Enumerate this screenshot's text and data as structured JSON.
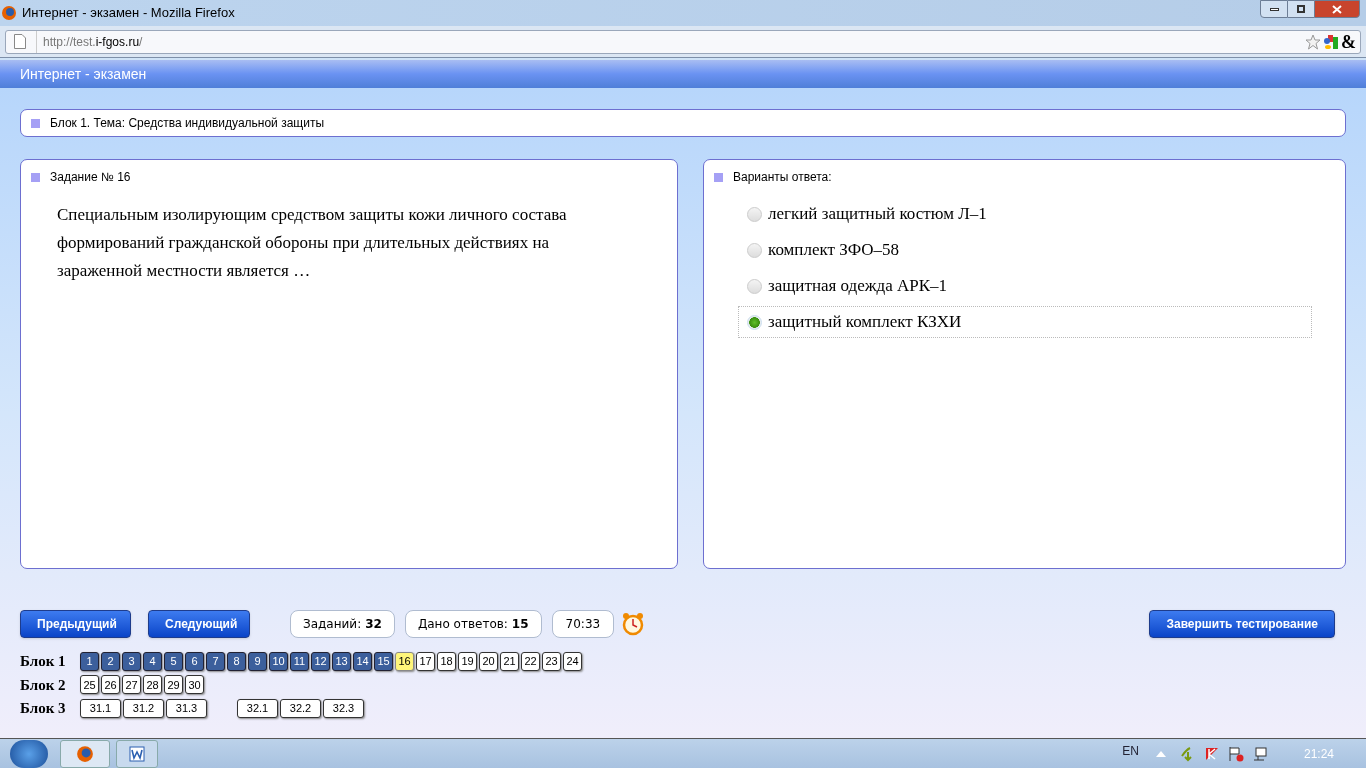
{
  "window": {
    "title": "Интернет - экзамен - Mozilla Firefox"
  },
  "address_bar": {
    "url_prefix": "http://test.",
    "url_domain": "i-fgos.ru",
    "url_suffix": "/",
    "addon_glyph": "&"
  },
  "app_header": {
    "title": "Интернет - экзамен"
  },
  "block_bar": {
    "label": "Блок 1. Тема: Средства индивидуальной защиты"
  },
  "question": {
    "heading": "Задание № 16",
    "text": "Специальным изолирующим средством защиты кожи личного состава формирований гражданской обороны при длительных действиях на зараженной местности является …"
  },
  "answers": {
    "heading": "Варианты ответа:",
    "options": [
      {
        "label": "легкий защитный костюм Л–1",
        "selected": false
      },
      {
        "label": "комплект ЗФО–58",
        "selected": false
      },
      {
        "label": "защитная одежда АРК–1",
        "selected": false
      },
      {
        "label": "защитный комплект КЗХИ",
        "selected": true
      }
    ]
  },
  "controls": {
    "prev": "Предыдущий",
    "next": "Следующий",
    "tasks_label": "Заданий:",
    "tasks_value": "32",
    "answered_label": "Дано ответов:",
    "answered_value": "15",
    "timer": "70:33",
    "finish": "Завершить тестирование"
  },
  "navigator": [
    {
      "label": "Блок 1",
      "groups": [
        [
          {
            "label": "1",
            "answered": true,
            "selected": false
          },
          {
            "label": "2",
            "answered": true,
            "selected": false
          },
          {
            "label": "3",
            "answered": true,
            "selected": false
          },
          {
            "label": "4",
            "answered": true,
            "selected": false
          },
          {
            "label": "5",
            "answered": true,
            "selected": false
          },
          {
            "label": "6",
            "answered": true,
            "selected": false
          },
          {
            "label": "7",
            "answered": true,
            "selected": false
          },
          {
            "label": "8",
            "answered": true,
            "selected": false
          },
          {
            "label": "9",
            "answered": true,
            "selected": false
          },
          {
            "label": "10",
            "answered": true,
            "selected": false
          },
          {
            "label": "11",
            "answered": true,
            "selected": false
          },
          {
            "label": "12",
            "answered": true,
            "selected": false
          },
          {
            "label": "13",
            "answered": true,
            "selected": false
          },
          {
            "label": "14",
            "answered": true,
            "selected": false
          },
          {
            "label": "15",
            "answered": true,
            "selected": false
          },
          {
            "label": "16",
            "answered": false,
            "selected": true
          },
          {
            "label": "17",
            "answered": false,
            "selected": false
          },
          {
            "label": "18",
            "answered": false,
            "selected": false
          },
          {
            "label": "19",
            "answered": false,
            "selected": false
          },
          {
            "label": "20",
            "answered": false,
            "selected": false
          },
          {
            "label": "21",
            "answered": false,
            "selected": false
          },
          {
            "label": "22",
            "answered": false,
            "selected": false
          },
          {
            "label": "23",
            "answered": false,
            "selected": false
          },
          {
            "label": "24",
            "answered": false,
            "selected": false
          }
        ]
      ]
    },
    {
      "label": "Блок 2",
      "groups": [
        [
          {
            "label": "25",
            "answered": false,
            "selected": false
          },
          {
            "label": "26",
            "answered": false,
            "selected": false
          },
          {
            "label": "27",
            "answered": false,
            "selected": false
          },
          {
            "label": "28",
            "answered": false,
            "selected": false
          },
          {
            "label": "29",
            "answered": false,
            "selected": false
          },
          {
            "label": "30",
            "answered": false,
            "selected": false
          }
        ]
      ]
    },
    {
      "label": "Блок 3",
      "groups": [
        [
          {
            "label": "31.1",
            "answered": false,
            "selected": false
          },
          {
            "label": "31.2",
            "answered": false,
            "selected": false
          },
          {
            "label": "31.3",
            "answered": false,
            "selected": false
          }
        ],
        [
          {
            "label": "32.1",
            "answered": false,
            "selected": false
          },
          {
            "label": "32.2",
            "answered": false,
            "selected": false
          },
          {
            "label": "32.3",
            "answered": false,
            "selected": false
          }
        ]
      ]
    }
  ],
  "taskbar": {
    "language": "EN",
    "clock": "21:24"
  }
}
